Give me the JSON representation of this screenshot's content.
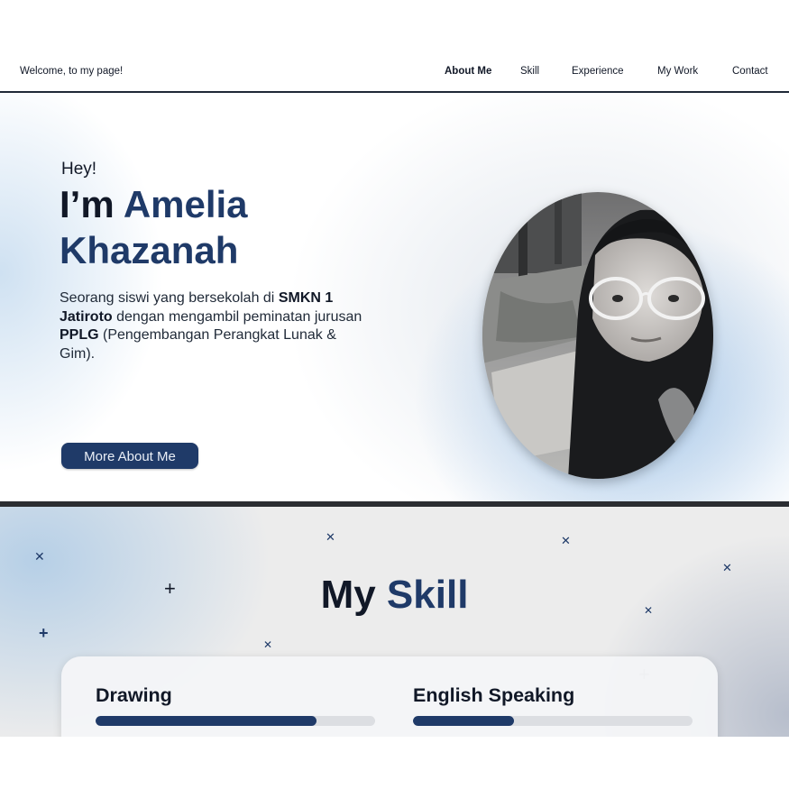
{
  "nav": {
    "welcome": "Welcome, to my page!",
    "items": [
      {
        "label": "About Me",
        "active": true
      },
      {
        "label": "Skill",
        "active": false
      },
      {
        "label": "Experience",
        "active": false
      },
      {
        "label": "My Work",
        "active": false
      },
      {
        "label": "Contact",
        "active": false
      }
    ]
  },
  "hero": {
    "greeting": "Hey!",
    "title_prefix": "I’m",
    "name_first": "Amelia",
    "name_last": "Khazanah",
    "desc": {
      "p1": "Seorang siswi yang bersekolah di ",
      "school": "SMKN 1 Jatiroto",
      "p2": " dengan mengambil peminatan jurusan ",
      "major": "PPLG",
      "p3": " (Pengembangan Perangkat Lunak & Gim)."
    },
    "button_label": "More About Me",
    "photo_icon": "profile-photo"
  },
  "skills": {
    "title_prefix": "My",
    "title_highlight": "Skill",
    "items": [
      {
        "label": "Drawing",
        "level": 0.79
      },
      {
        "label": "English Speaking",
        "level": 0.36
      }
    ]
  },
  "colors": {
    "accent": "#1f3a68",
    "text": "#111827",
    "divider": "#2b2d31"
  }
}
